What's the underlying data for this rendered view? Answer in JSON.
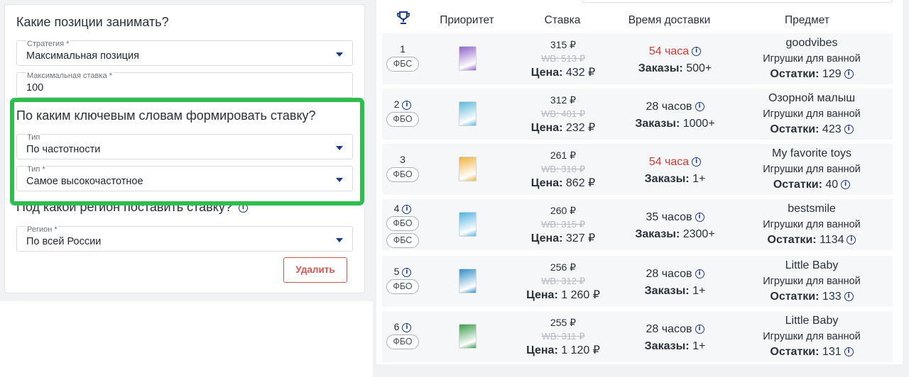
{
  "left": {
    "section1_title": "Какие позиции занимать?",
    "strategy": {
      "label": "Стратегия *",
      "value": "Максимальная позиция"
    },
    "max_bid": {
      "label": "Максимальная ставка *",
      "value": "100"
    },
    "section2_title": "По каким ключевым словам формировать ставку?",
    "type1": {
      "label": "Тип",
      "value": "По частотности"
    },
    "type2": {
      "label": "Тип *",
      "value": "Самое высокочастотное"
    },
    "section3_title": "Под какой регион поставить ставку?",
    "region": {
      "label": "Регион *",
      "value": "По всей России"
    },
    "delete_label": "Удалить"
  },
  "table": {
    "headers": {
      "priority": "Приоритет",
      "bid": "Ставка",
      "delivery": "Время доставки",
      "subject": "Предмет"
    },
    "price_label": "Цена:",
    "orders_label": "Заказы:",
    "stock_label": "Остатки:",
    "rows": [
      {
        "pos": "1",
        "badges": [
          "ФБС"
        ],
        "bid": "315 ₽",
        "wb_old": "WB: 513 ₽",
        "price": "432 ₽",
        "delivery": "54 часа",
        "delivery_red": true,
        "orders": "500+",
        "brand": "goodvibes",
        "category": "Игрушки для ванной",
        "stock": "129",
        "pos_info": false,
        "thumb_color": "#8e63c9"
      },
      {
        "pos": "2",
        "badges": [
          "ФБО"
        ],
        "bid": "312 ₽",
        "wb_old": "WB: 401 ₽",
        "price": "232 ₽",
        "delivery": "28 часов",
        "delivery_red": false,
        "orders": "1000+",
        "brand": "Озорной малыш",
        "category": "Игрушки для ванной",
        "stock": "423",
        "pos_info": true,
        "thumb_color": "#5bb8d9"
      },
      {
        "pos": "3",
        "badges": [
          "ФБО"
        ],
        "bid": "261 ₽",
        "wb_old": "WB: 318 ₽",
        "price": "862 ₽",
        "delivery": "54 часа",
        "delivery_red": true,
        "orders": "1+",
        "brand": "My favorite toys",
        "category": "Игрушки для ванной",
        "stock": "40",
        "pos_info": false,
        "thumb_color": "#f2b13b"
      },
      {
        "pos": "4",
        "badges": [
          "ФБО",
          "ФБС"
        ],
        "bid": "260 ₽",
        "wb_old": "WB: 315 ₽",
        "price": "327 ₽",
        "delivery": "35 часов",
        "delivery_red": false,
        "orders": "2300+",
        "brand": "bestsmile",
        "category": "Игрушки для ванной",
        "stock": "1134",
        "pos_info": true,
        "thumb_color": "#4fb4e0"
      },
      {
        "pos": "5",
        "badges": [
          "ФБО"
        ],
        "bid": "256 ₽",
        "wb_old": "WB: 312 ₽",
        "price": "1 260 ₽",
        "delivery": "28 часов",
        "delivery_red": false,
        "orders": "1+",
        "brand": "Little Baby",
        "category": "Игрушки для ванной",
        "stock": "133",
        "pos_info": true,
        "thumb_color": "#2f8fc7"
      },
      {
        "pos": "6",
        "badges": [
          "ФБО"
        ],
        "bid": "255 ₽",
        "wb_old": "WB: 311 ₽",
        "price": "1 120 ₽",
        "delivery": "28 часов",
        "delivery_red": false,
        "orders": "1+",
        "brand": "Little Baby",
        "category": "Игрушки для ванной",
        "stock": "131",
        "pos_info": true,
        "thumb_color": "#3b9b4a"
      }
    ]
  },
  "colors": {
    "accent": "#1b3a8c",
    "highlight_border": "#2fbe4e",
    "danger": "#d9534f",
    "delivery_red": "#d63a2f"
  }
}
